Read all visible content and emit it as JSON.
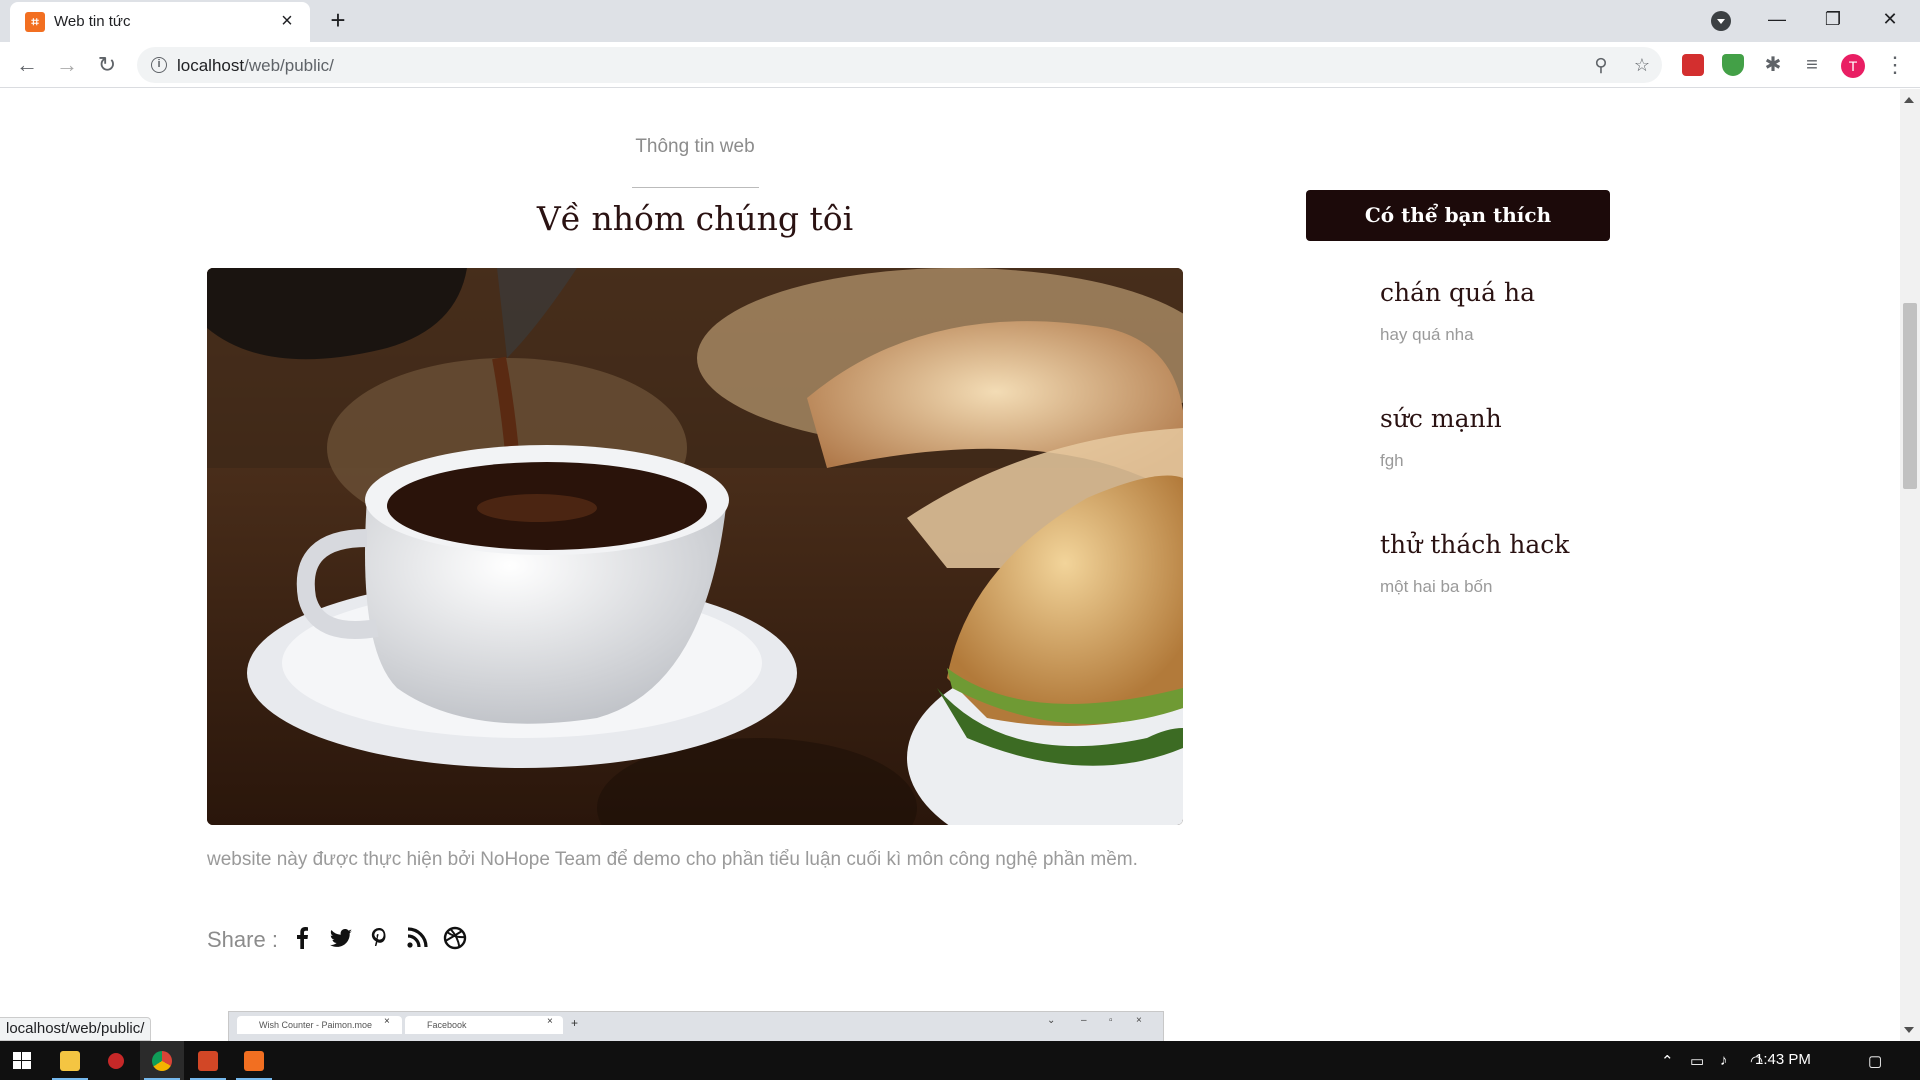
{
  "browser": {
    "tab_title": "Web tin tức",
    "url_host": "localhost",
    "url_path": "/web/public/",
    "status_url": "localhost/web/public/",
    "profile_initial": "T"
  },
  "post": {
    "category": "Thông tin web",
    "title": "Về nhóm chúng tôi",
    "body": "website này được thực hiện bởi NoHope Team để demo cho phần tiểu luận cuối kì môn công nghệ phần mềm.",
    "share_label": "Share :",
    "share_icons": [
      "facebook-icon",
      "twitter-icon",
      "pinterest-icon",
      "rss-icon",
      "dribbble-icon"
    ]
  },
  "sidebar": {
    "heading": "Có thể bạn thích",
    "items": [
      {
        "title": "chán quá ha",
        "subtitle": "hay quá nha"
      },
      {
        "title": "sức mạnh",
        "subtitle": "fgh"
      },
      {
        "title": "thử thách hack",
        "subtitle": "một hai ba bốn"
      }
    ]
  },
  "embedded_screenshot": {
    "tab1": "Wish Counter - Paimon.moe",
    "tab2": "Facebook"
  },
  "taskbar": {
    "time": "1:43 PM"
  },
  "colors": {
    "accent_dark": "#1c0a0a",
    "title_text": "#2a1212",
    "muted_text": "#9a9a9a",
    "avatar": "#e91e63"
  }
}
